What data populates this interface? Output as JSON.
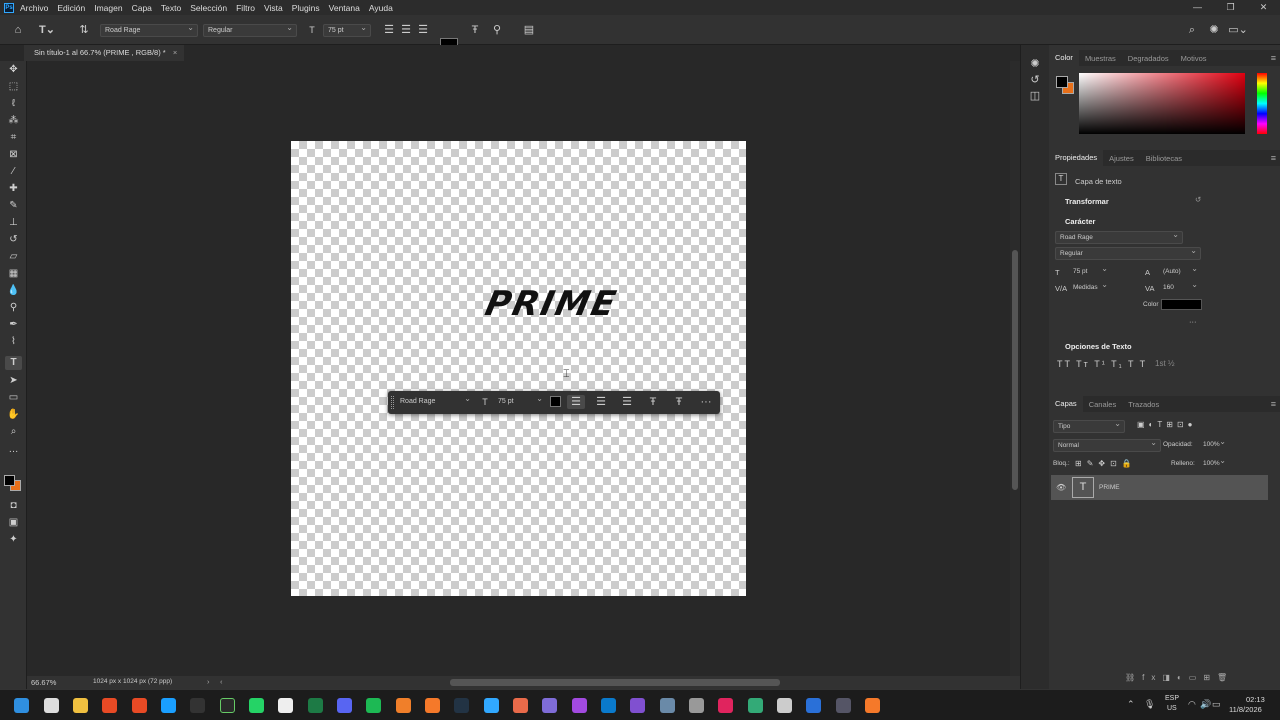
{
  "menu": {
    "app_logo": "Ps",
    "items": [
      "Archivo",
      "Edición",
      "Imagen",
      "Capa",
      "Texto",
      "Selección",
      "Filtro",
      "Vista",
      "Plugins",
      "Ventana",
      "Ayuda"
    ]
  },
  "options": {
    "font_family": "Road Rage",
    "font_style": "Regular",
    "font_size": "75 pt"
  },
  "document": {
    "tab_title": "Sin título-1 al 66.7% (PRIME , RGB/8) *",
    "text": "PRIME"
  },
  "context_bar": {
    "font_family": "Road Rage",
    "font_size": "75 pt"
  },
  "status": {
    "zoom": "66.67%",
    "doc_info": "1024 px x 1024 px (72 ppp)"
  },
  "color_panel": {
    "tabs": [
      "Color",
      "Muestras",
      "Degradados",
      "Motivos"
    ]
  },
  "properties": {
    "tabs": [
      "Propiedades",
      "Ajustes",
      "Bibliotecas"
    ],
    "layer_kind": "Capa de texto",
    "transform": "Transformar",
    "character": "Carácter",
    "font_family": "Road Rage",
    "font_style": "Regular",
    "font_size": "75 pt",
    "leading": "(Auto)",
    "kerning": "Medidas",
    "tracking": "160",
    "color_label": "Color",
    "text_options": "Opciones de Texto",
    "text_style_glyphs": "TT Tт T¹ T₁ T T",
    "fraction": "1st ½"
  },
  "layers": {
    "tabs": [
      "Capas",
      "Canales",
      "Trazados"
    ],
    "filter": "Tipo",
    "blend_mode": "Normal",
    "opacity_label": "Opacidad:",
    "opacity": "100%",
    "lock_label": "Bloq.:",
    "fill_label": "Relleno:",
    "fill": "100%",
    "items": [
      {
        "name": "PRIME"
      }
    ]
  },
  "taskbar": {
    "lang_top": "ESP",
    "lang_bottom": "US",
    "time": "02:13",
    "date": "11/8/2026"
  },
  "colors": {
    "accent": "#31a8ff",
    "background_swatch": "#e8701a"
  }
}
